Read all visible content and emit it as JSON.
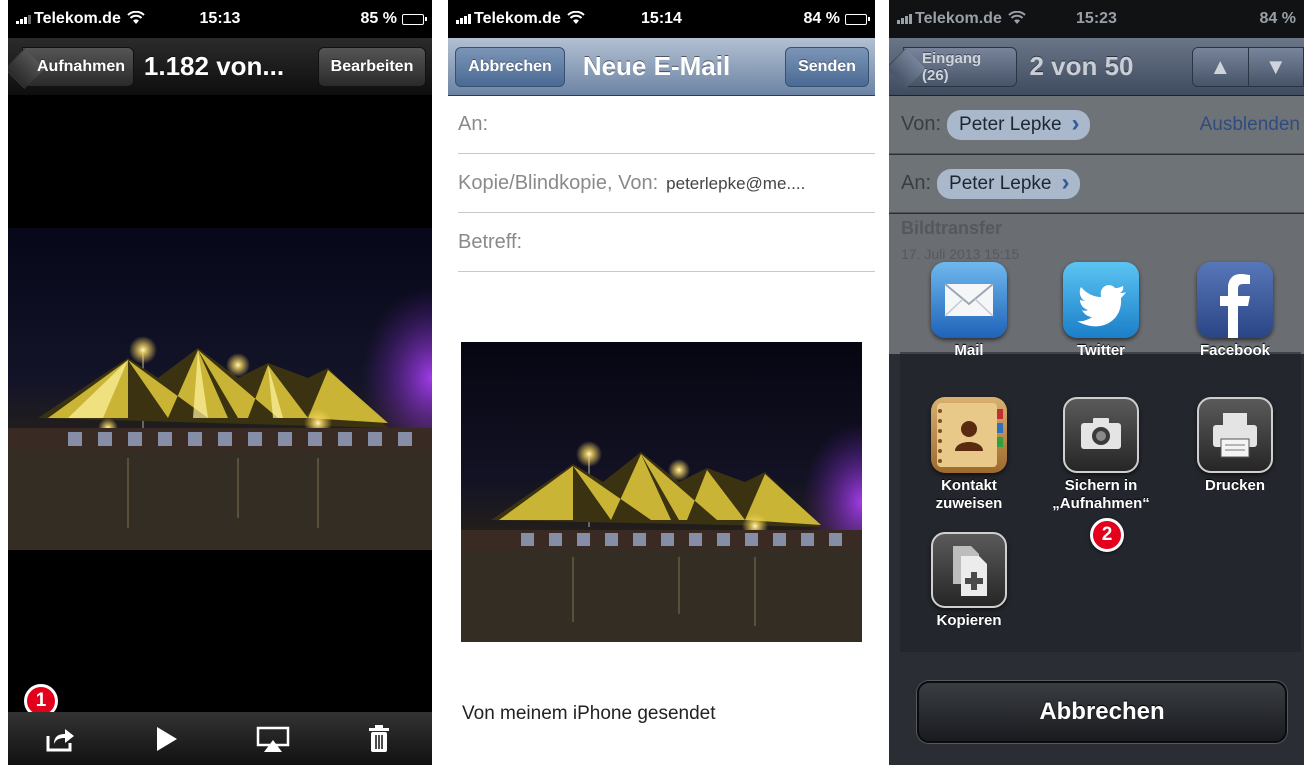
{
  "panel1": {
    "status": {
      "carrier": "Telekom.de",
      "time": "15:13",
      "battery": "85 %",
      "battery_level": 0.85
    },
    "nav": {
      "back": "Aufnahmen",
      "title": "1.182 von...",
      "edit": "Bearbeiten"
    },
    "toolbar": {
      "icons": [
        "share-icon",
        "play-icon",
        "airplay-icon",
        "trash-icon"
      ]
    },
    "callout": "1"
  },
  "panel2": {
    "status": {
      "carrier": "Telekom.de",
      "time": "15:14",
      "battery": "84 %",
      "battery_level": 0.84
    },
    "nav": {
      "cancel": "Abbrechen",
      "title": "Neue E-Mail",
      "send": "Senden"
    },
    "fields": {
      "to_label": "An:",
      "cc_label": "Kopie/Blindkopie, Von:",
      "cc_value": "peterlepke@me....",
      "subject_label": "Betreff:"
    },
    "signature": "Von meinem iPhone gesendet"
  },
  "panel3": {
    "status": {
      "carrier": "Telekom.de",
      "time": "15:23",
      "battery": "84 %",
      "battery_level": 0.84
    },
    "nav": {
      "back": "Eingang (26)",
      "title": "2 von 50",
      "up": "▲",
      "down": "▼"
    },
    "from_label": "Von:",
    "from_name": "Peter Lepke",
    "hide": "Ausblenden",
    "to_label": "An:",
    "to_name": "Peter Lepke",
    "subject": "Bildtransfer",
    "date": "17. Juli 2013 15:15",
    "share_items": {
      "mail": "Mail",
      "twitter": "Twitter",
      "facebook": "Facebook",
      "contact_line1": "Kontakt",
      "contact_line2": "zuweisen",
      "save_line1": "Sichern in",
      "save_line2": "„Aufnahmen“",
      "print": "Drucken",
      "copy": "Kopieren"
    },
    "callout": "2",
    "cancel": "Abbrechen"
  },
  "colors": {
    "callout_red": "#e2001a",
    "mail_nav_blue": "#6c84a4",
    "link_blue": "#2f4c80"
  }
}
